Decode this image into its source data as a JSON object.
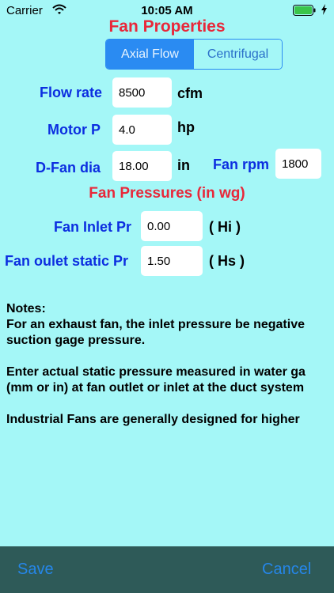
{
  "status": {
    "carrier": "Carrier",
    "time": "10:05 AM"
  },
  "title": "Fan Properties",
  "segments": {
    "axial": "Axial Flow",
    "centrifugal": "Centrifugal"
  },
  "fields": {
    "flow_rate": {
      "label": "Flow rate",
      "value": "8500",
      "unit": "cfm"
    },
    "motor_p": {
      "label": "Motor P",
      "value": "4.0",
      "unit": "hp"
    },
    "fan_dia": {
      "label": "D-Fan dia",
      "value": "18.00",
      "unit": "in"
    },
    "fan_rpm": {
      "label": "Fan rpm",
      "value": "1800"
    }
  },
  "pressures": {
    "title": "Fan Pressures (in wg)",
    "inlet": {
      "label": "Fan Inlet Pr",
      "value": "0.00",
      "unit": "( Hi )"
    },
    "outlet": {
      "label": "Fan oulet static Pr",
      "value": "1.50",
      "unit": "( Hs )"
    }
  },
  "notes": {
    "heading": "Notes:",
    "line1": "For an exhaust fan, the inlet pressure be negative",
    "line2": "suction gage pressure.",
    "line3": "Enter actual static pressure measured in water ga",
    "line4": "(mm or in) at fan outlet or inlet at the duct system",
    "line5": "Industrial Fans are generally designed for higher"
  },
  "toolbar": {
    "save": "Save",
    "cancel": "Cancel"
  },
  "colors": {
    "background": "#a4f7f7",
    "accent": "#2a8bf2",
    "title_red": "#e8283a",
    "label_blue": "#0c2ee0",
    "toolbar": "#2e5a58"
  },
  "icons": {
    "wifi": "wifi-icon",
    "battery": "battery-icon",
    "charging": "charging-bolt-icon"
  }
}
